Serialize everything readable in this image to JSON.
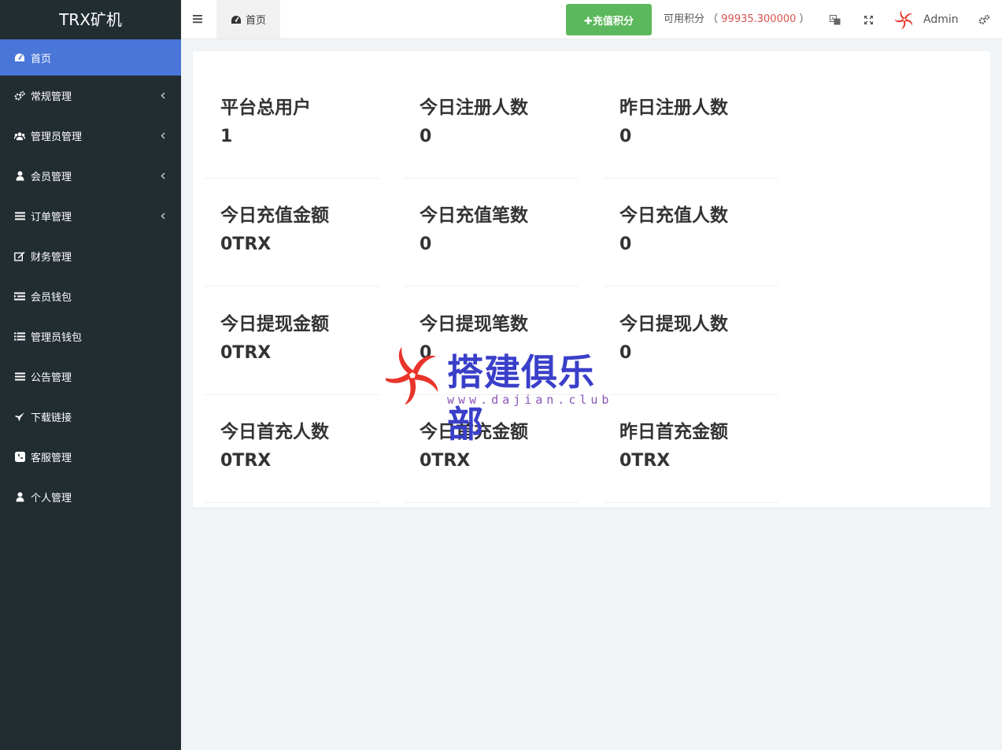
{
  "brand": "TRX矿机",
  "sidebar": {
    "items": [
      {
        "label": "首页",
        "icon": "dashboard-icon",
        "active": true,
        "has_children": false
      },
      {
        "label": "常规管理",
        "icon": "cogs-icon",
        "active": false,
        "has_children": true
      },
      {
        "label": "管理员管理",
        "icon": "users-icon",
        "active": false,
        "has_children": true
      },
      {
        "label": "会员管理",
        "icon": "user-icon",
        "active": false,
        "has_children": true
      },
      {
        "label": "订单管理",
        "icon": "bars-icon",
        "active": false,
        "has_children": true
      },
      {
        "label": "财务管理",
        "icon": "edit-icon",
        "active": false,
        "has_children": false
      },
      {
        "label": "会员钱包",
        "icon": "list-icon",
        "active": false,
        "has_children": false
      },
      {
        "label": "管理员钱包",
        "icon": "list-ul-icon",
        "active": false,
        "has_children": false
      },
      {
        "label": "公告管理",
        "icon": "bars-icon",
        "active": false,
        "has_children": false
      },
      {
        "label": "下载链接",
        "icon": "plane-icon",
        "active": false,
        "has_children": false
      },
      {
        "label": "客服管理",
        "icon": "phone-icon",
        "active": false,
        "has_children": false
      },
      {
        "label": "个人管理",
        "icon": "user-icon",
        "active": false,
        "has_children": false
      }
    ]
  },
  "header": {
    "home_tab": "首页",
    "recharge_button": "✚充值积分",
    "points_label": "可用积分 （",
    "points_value": "99935.300000",
    "points_close": "）",
    "username": "Admin"
  },
  "stats": [
    {
      "label": "平台总用户",
      "value": "1"
    },
    {
      "label": "今日注册人数",
      "value": "0"
    },
    {
      "label": "昨日注册人数",
      "value": "0"
    },
    {
      "label": "今日充值金额",
      "value": "0TRX"
    },
    {
      "label": "今日充值笔数",
      "value": "0"
    },
    {
      "label": "今日充值人数",
      "value": "0"
    },
    {
      "label": "今日提现金额",
      "value": "0TRX"
    },
    {
      "label": "今日提现笔数",
      "value": "0"
    },
    {
      "label": "今日提现人数",
      "value": "0"
    },
    {
      "label": "今日首充人数",
      "value": "0TRX"
    },
    {
      "label": "今日首充金额",
      "value": "0TRX"
    },
    {
      "label": "昨日首充金额",
      "value": "0TRX"
    }
  ],
  "watermark": {
    "title": "搭建俱乐部",
    "url": "www.dajian.club"
  },
  "colors": {
    "sidebar_bg": "#222d32",
    "active_item": "#4a76d9",
    "recharge_green": "#5cb85c",
    "points_red": "#d9534f"
  }
}
